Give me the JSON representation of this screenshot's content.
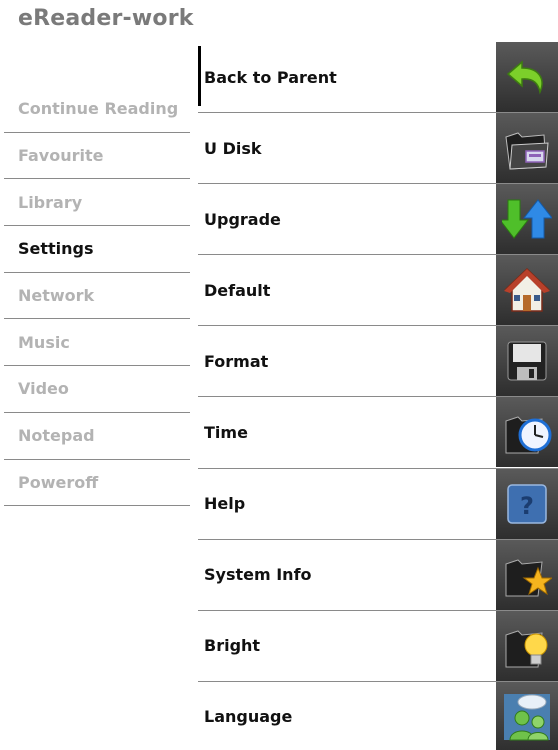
{
  "app": {
    "title": "eReader-work"
  },
  "sidebar": {
    "items": [
      {
        "label": "Continue Reading",
        "active": false
      },
      {
        "label": "Favourite",
        "active": false
      },
      {
        "label": "Library",
        "active": false
      },
      {
        "label": "Settings",
        "active": true
      },
      {
        "label": "Network",
        "active": false
      },
      {
        "label": "Music",
        "active": false
      },
      {
        "label": "Video",
        "active": false
      },
      {
        "label": "Notepad",
        "active": false
      },
      {
        "label": "Poweroff",
        "active": false
      }
    ]
  },
  "settings_menu": {
    "items": [
      {
        "label": "Back to Parent",
        "icon": "back-arrow-icon",
        "selected": true
      },
      {
        "label": "U Disk",
        "icon": "usb-folder-icon"
      },
      {
        "label": "Upgrade",
        "icon": "upgrade-arrows-icon"
      },
      {
        "label": "Default",
        "icon": "home-icon"
      },
      {
        "label": "Format",
        "icon": "floppy-disk-icon"
      },
      {
        "label": "Time",
        "icon": "clock-icon"
      },
      {
        "label": "Help",
        "icon": "help-icon"
      },
      {
        "label": "System Info",
        "icon": "star-folder-icon"
      },
      {
        "label": "Bright",
        "icon": "lightbulb-icon"
      },
      {
        "label": "Language",
        "icon": "language-people-icon"
      }
    ]
  },
  "colors": {
    "active_text": "#111111",
    "inactive_text": "#b3b3b3",
    "tile_background": "#3a3a3a"
  }
}
